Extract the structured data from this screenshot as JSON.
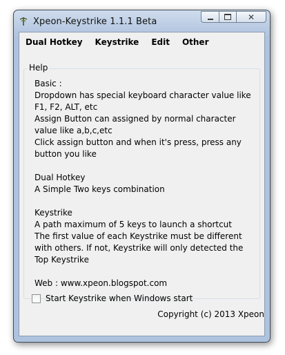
{
  "window": {
    "title": "Xpeon-Keystrike 1.1.1 Beta",
    "app_icon": "keystrike-app-icon",
    "caption_buttons": [
      "minimize",
      "maximize",
      "close"
    ]
  },
  "menu": {
    "items": [
      "Dual Hotkey",
      "Keystrike",
      "Edit",
      "Other"
    ]
  },
  "help": {
    "legend": "Help",
    "lines": [
      "Basic :",
      "Dropdown has special keyboard character value like",
      "F1, F2, ALT, etc",
      "Assign Button can assigned by normal character",
      "value like a,b,c,etc",
      "Click assign button and when it's press, press any",
      "button you like",
      "",
      "Dual Hotkey",
      "A Simple Two keys combination",
      "",
      "Keystrike",
      "A path maximum of 5 keys to launch a shortcut",
      "The first value of each Keystrike must be different",
      "with others. If not, Keystrike will only detected the",
      "Top Keystrike",
      "",
      "Web : www.xpeon.blogspot.com"
    ]
  },
  "startup": {
    "label": "Start Keystrike when Windows start",
    "checked": false
  },
  "footer": {
    "copyright": "Copyright (c) 2013 Xpeon"
  }
}
